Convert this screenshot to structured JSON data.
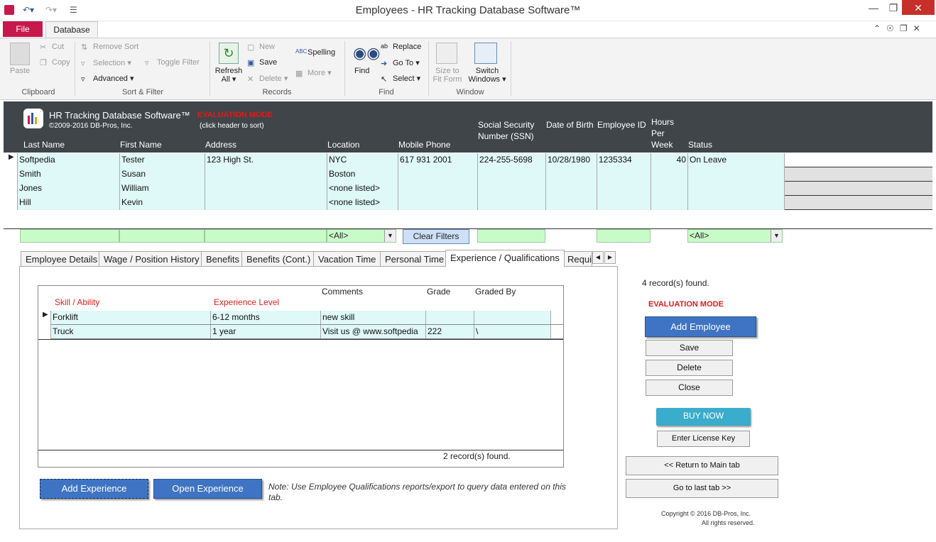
{
  "window": {
    "title": "Employees  -  HR Tracking Database Software™"
  },
  "ribbon": {
    "tabs": {
      "file": "File",
      "database": "Database"
    },
    "clipboard": {
      "label": "Clipboard",
      "paste": "Paste",
      "cut": "Cut",
      "copy": "Copy"
    },
    "sort_filter": {
      "label": "Sort & Filter",
      "remove_sort": "Remove Sort",
      "selection": "Selection",
      "advanced": "Advanced",
      "toggle_filter": "Toggle Filter"
    },
    "records": {
      "label": "Records",
      "refresh": "Refresh",
      "refresh2": "All",
      "new": "New",
      "save": "Save",
      "delete": "Delete",
      "spelling": "Spelling",
      "more": "More"
    },
    "find": {
      "label": "Find",
      "find": "Find",
      "replace": "Replace",
      "goto": "Go To",
      "select": "Select"
    },
    "window": {
      "label": "Window",
      "size1": "Size to",
      "size2": "Fit Form",
      "switch1": "Switch",
      "switch2": "Windows"
    }
  },
  "app": {
    "name": "HR Tracking Database Software™",
    "copyright": "©2009-2016 DB-Pros, Inc.",
    "eval": "EVALUATION MODE",
    "hint": "(click header to sort)"
  },
  "columns": {
    "last": "Last Name",
    "first": "First Name",
    "address": "Address",
    "location": "Location",
    "mobile": "Mobile Phone",
    "ssn1": "Social Security",
    "ssn2": "Number (SSN)",
    "dob": "Date of Birth",
    "empid": "Employee ID",
    "hours1": "Hours",
    "hours2": "Per",
    "hours3": "Week",
    "status": "Status"
  },
  "employees": [
    {
      "last": "Softpedia",
      "first": "Tester",
      "address": "123 High St.",
      "location": "NYC",
      "mobile": "617 931 2001",
      "ssn": "224-255-5698",
      "dob": "10/28/1980",
      "empid": "1235334",
      "hours": "40",
      "status": "On Leave"
    },
    {
      "last": "Smith",
      "first": "Susan",
      "address": "",
      "location": "Boston",
      "mobile": "",
      "ssn": "",
      "dob": "",
      "empid": "",
      "hours": "",
      "status": ""
    },
    {
      "last": "Jones",
      "first": "William",
      "address": "",
      "location": "<none listed>",
      "mobile": "",
      "ssn": "",
      "dob": "",
      "empid": "",
      "hours": "",
      "status": ""
    },
    {
      "last": "Hill",
      "first": "Kevin",
      "address": "",
      "location": "<none listed>",
      "mobile": "",
      "ssn": "",
      "dob": "",
      "empid": "",
      "hours": "",
      "status": ""
    }
  ],
  "filters": {
    "location": "<All>",
    "clear": "Clear Filters",
    "status": "<All>"
  },
  "tabs": [
    "Employee Details",
    "Wage / Position History",
    "Benefits",
    "Benefits (Cont.)",
    "Vacation Time",
    "Personal Time",
    "Experience / Qualifications",
    "Requi"
  ],
  "experience": {
    "headers": {
      "skill": "Skill / Ability",
      "level": "Experience Level",
      "comments": "Comments",
      "grade": "Grade",
      "graded_by": "Graded By"
    },
    "rows": [
      {
        "skill": "Forklift",
        "level": "6-12 months",
        "comments": "new skill",
        "grade": "",
        "graded_by": ""
      },
      {
        "skill": "Truck",
        "level": "1 year",
        "comments": "Visit us @ www.softpedia",
        "grade": "222",
        "graded_by": "\\"
      }
    ],
    "count": "2",
    "count_label": "record(s) found.",
    "add": "Add Experience",
    "open": "Open Experience",
    "note": "Note: Use Employee Qualifications reports/export to query data entered on this tab."
  },
  "side": {
    "count": "4",
    "count_label": "record(s) found.",
    "eval": "EVALUATION MODE",
    "add": "Add Employee",
    "save": "Save",
    "delete": "Delete",
    "close": "Close",
    "buy": "BUY NOW",
    "license": "Enter License Key",
    "return": "<< Return to Main tab",
    "last": "Go to last tab >>",
    "copy1": "Copyright © 2016 DB-Pros, Inc.",
    "copy2": "All rights reserved."
  },
  "colors": {
    "header_bg": "#404549",
    "cell_bg": "#dff8f8",
    "filter_bg": "#c9fbc9",
    "eval": "#e01b1b",
    "file_tab": "#c8194c",
    "button_blue": "#3f74c4"
  }
}
